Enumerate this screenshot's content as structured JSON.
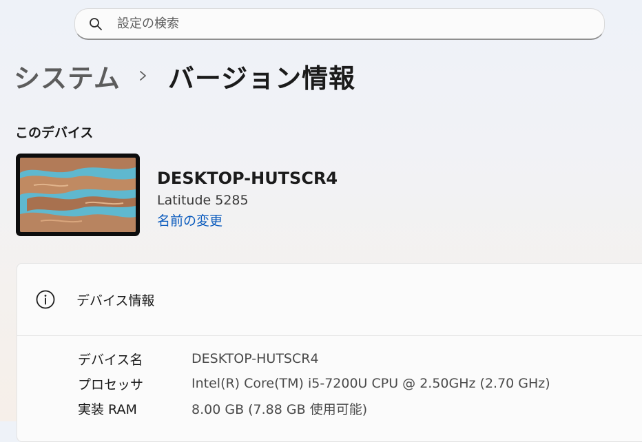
{
  "search": {
    "placeholder": "設定の検索",
    "icon": "search-icon"
  },
  "breadcrumb": {
    "parent": "システム",
    "separator_icon": "chevron-right-icon",
    "current": "バージョン情報"
  },
  "device_section": {
    "title": "このデバイス",
    "device_name": "DESKTOP-HUTSCR4",
    "model": "Latitude 5285",
    "rename_link": "名前の変更"
  },
  "device_specs": {
    "icon": "info-icon",
    "title": "デバイス情報",
    "rows": [
      {
        "label": "デバイス名",
        "value": "DESKTOP-HUTSCR4"
      },
      {
        "label": "プロセッサ",
        "value": "Intel(R) Core(TM) i5-7200U CPU @ 2.50GHz (2.70 GHz)"
      },
      {
        "label": "実装 RAM",
        "value": "8.00 GB (7.88 GB 使用可能)"
      }
    ]
  },
  "colors": {
    "accent_link": "#0a5bbd",
    "text_primary": "#1b1b1b",
    "text_secondary": "#4a4a4a"
  }
}
